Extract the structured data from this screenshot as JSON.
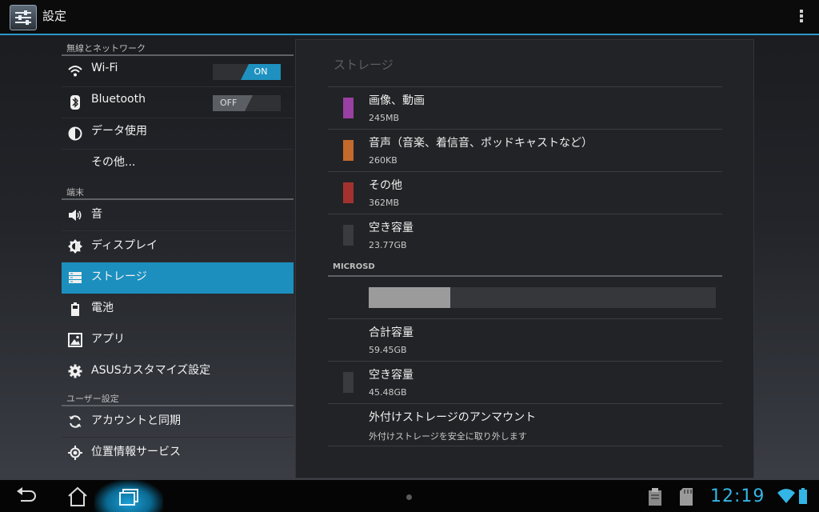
{
  "actionbar": {
    "title": "設定",
    "app_icon": "settings-sliders-icon",
    "overflow_icon": "overflow-menu-icon"
  },
  "sidebar": {
    "sections": [
      {
        "header": "無線とネットワーク",
        "items": [
          {
            "label": "Wi-Fi",
            "icon": "wifi-icon",
            "toggle": "ON"
          },
          {
            "label": "Bluetooth",
            "icon": "bluetooth-icon",
            "toggle": "OFF"
          },
          {
            "label": "データ使用",
            "icon": "data-usage-icon"
          },
          {
            "label": "その他...",
            "icon": ""
          }
        ]
      },
      {
        "header": "端末",
        "items": [
          {
            "label": "音",
            "icon": "speaker-icon"
          },
          {
            "label": "ディスプレイ",
            "icon": "brightness-icon"
          },
          {
            "label": "ストレージ",
            "icon": "storage-icon",
            "active": true
          },
          {
            "label": "電池",
            "icon": "battery-icon"
          },
          {
            "label": "アプリ",
            "icon": "apps-icon"
          },
          {
            "label": "ASUSカスタマイズ設定",
            "icon": "gear-icon"
          }
        ]
      },
      {
        "header": "ユーザー設定",
        "items": [
          {
            "label": "アカウントと同期",
            "icon": "sync-icon"
          },
          {
            "label": "位置情報サービス",
            "icon": "location-icon"
          }
        ]
      }
    ]
  },
  "storage": {
    "title": "ストレージ",
    "internal": [
      {
        "label": "画像、動画",
        "value": "245MB",
        "color": "#9a3fa3"
      },
      {
        "label": "音声（音楽、着信音、ポッドキャストなど）",
        "value": "260KB",
        "color": "#c46a2c"
      },
      {
        "label": "その他",
        "value": "362MB",
        "color": "#a3322f"
      },
      {
        "label": "空き容量",
        "value": "23.77GB",
        "color": "#3a3b3e"
      }
    ],
    "microsd": {
      "header": "MICROSD",
      "used_fraction": 0.235,
      "total_label": "合計容量",
      "total_value": "59.45GB",
      "free_label": "空き容量",
      "free_value": "45.48GB",
      "free_color": "#3a3b3e",
      "unmount_label": "外付けストレージのアンマウント",
      "unmount_desc": "外付けストレージを安全に取り外します"
    }
  },
  "navbar": {
    "back_icon": "back-icon",
    "home_icon": "home-icon",
    "recents_icon": "recents-icon",
    "time": "12:19",
    "status_icons": [
      "clipboard-icon",
      "sd-card-icon",
      "wifi-signal-icon",
      "battery-status-icon"
    ]
  },
  "colors": {
    "accent": "#33b5e5",
    "active_item": "#1c8fbe"
  }
}
